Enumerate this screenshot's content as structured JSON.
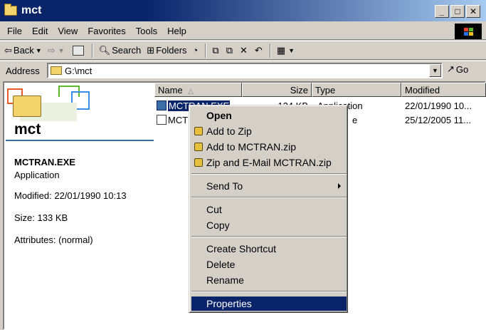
{
  "window": {
    "title": "mct"
  },
  "menubar": [
    "File",
    "Edit",
    "View",
    "Favorites",
    "Tools",
    "Help"
  ],
  "toolbar": {
    "back": "Back",
    "search": "Search",
    "folders": "Folders"
  },
  "address": {
    "label": "Address",
    "value": "G:\\mct",
    "go": "Go"
  },
  "leftpanel": {
    "folder_name": "mct",
    "selected_name": "MCTRAN.EXE",
    "selected_type": "Application",
    "modified": "Modified: 22/01/1990 10:13",
    "size": "Size: 133 KB",
    "attributes": "Attributes: (normal)"
  },
  "filelist": {
    "columns": {
      "name": "Name",
      "sort_indicator": "△",
      "size": "Size",
      "type": "Type",
      "modified": "Modified"
    },
    "rows": [
      {
        "name": "MCTRAN.EXE",
        "size": "134 KB",
        "type": "Application",
        "modified": "22/01/1990 10..."
      },
      {
        "name": "MCTF",
        "size": "",
        "type": "e",
        "modified": "25/12/2005 11..."
      }
    ]
  },
  "context_menu": {
    "open": "Open",
    "add_to_zip": "Add to Zip",
    "add_to_named_zip": "Add to MCTRAN.zip",
    "zip_email": "Zip and E-Mail MCTRAN.zip",
    "send_to": "Send To",
    "cut": "Cut",
    "copy": "Copy",
    "create_shortcut": "Create Shortcut",
    "delete": "Delete",
    "rename": "Rename",
    "properties": "Properties"
  },
  "colors": {
    "titlebar": "#0a246a",
    "selection": "#0a246a",
    "face": "#d4d0c8"
  }
}
